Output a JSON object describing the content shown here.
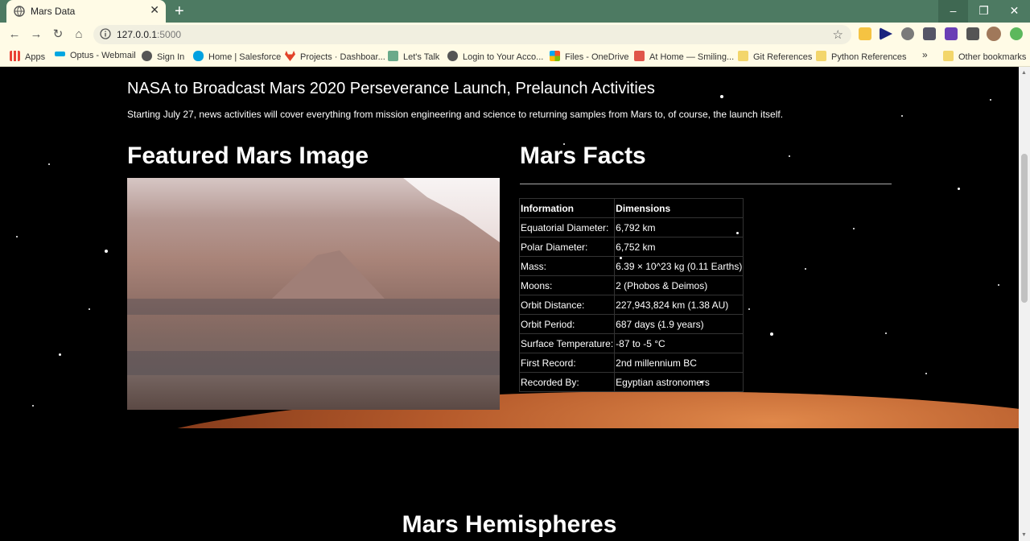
{
  "browser": {
    "tab_title": "Mars Data",
    "tab_close": "✕",
    "new_tab": "+",
    "window_controls": {
      "minimize": "–",
      "maximize": "❐",
      "close": "✕"
    },
    "url_host": "127.0.0.1",
    "url_port": ":5000",
    "bookmarks": [
      {
        "label": "Apps",
        "icon": "apps-grid-icon",
        "color": "#e94235"
      },
      {
        "label": "Optus - Webmail",
        "icon": "yes-icon",
        "color": "#00a7e1"
      },
      {
        "label": "Sign In",
        "icon": "globe-icon",
        "color": "#555555"
      },
      {
        "label": "Home | Salesforce",
        "icon": "salesforce-cloud-icon",
        "color": "#00a1e0"
      },
      {
        "label": "Projects · Dashboar...",
        "icon": "gitlab-icon",
        "color": "#e24329"
      },
      {
        "label": "Let's Talk",
        "icon": "chart-icon",
        "color": "#6aaa8a"
      },
      {
        "label": "Login to Your Acco...",
        "icon": "globe-icon",
        "color": "#555555"
      },
      {
        "label": "Files - OneDrive",
        "icon": "windows-icon",
        "color": "#f35325"
      },
      {
        "label": "At Home — Smiling...",
        "icon": "smile-icon",
        "color": "#e0564a"
      },
      {
        "label": "Git References",
        "icon": "folder-icon",
        "color": "#f3d66b"
      },
      {
        "label": "Python References",
        "icon": "folder-icon",
        "color": "#f3d66b"
      }
    ],
    "bookmarks_overflow": "»",
    "other_bookmarks": "Other bookmarks"
  },
  "news": {
    "title": "NASA to Broadcast Mars 2020 Perseverance Launch, Prelaunch Activities",
    "paragraph": "Starting July 27, news activities will cover everything from mission engineering and science to returning samples from Mars to, of course, the launch itself."
  },
  "featured": {
    "heading": "Featured Mars Image"
  },
  "facts": {
    "heading": "Mars Facts",
    "headers": [
      "Information",
      "Dimensions"
    ],
    "rows": [
      [
        "Equatorial Diameter:",
        "6,792 km"
      ],
      [
        "Polar Diameter:",
        "6,752 km"
      ],
      [
        "Mass:",
        "6.39 × 10^23 kg (0.11 Earths)"
      ],
      [
        "Moons:",
        "2 (Phobos & Deimos)"
      ],
      [
        "Orbit Distance:",
        "227,943,824 km (1.38 AU)"
      ],
      [
        "Orbit Period:",
        "687 days (1.9 years)"
      ],
      [
        "Surface Temperature:",
        "-87 to -5 °C"
      ],
      [
        "First Record:",
        "2nd millennium BC"
      ],
      [
        "Recorded By:",
        "Egyptian astronomers"
      ]
    ]
  },
  "hemispheres": {
    "heading": "Mars Hemispheres"
  }
}
